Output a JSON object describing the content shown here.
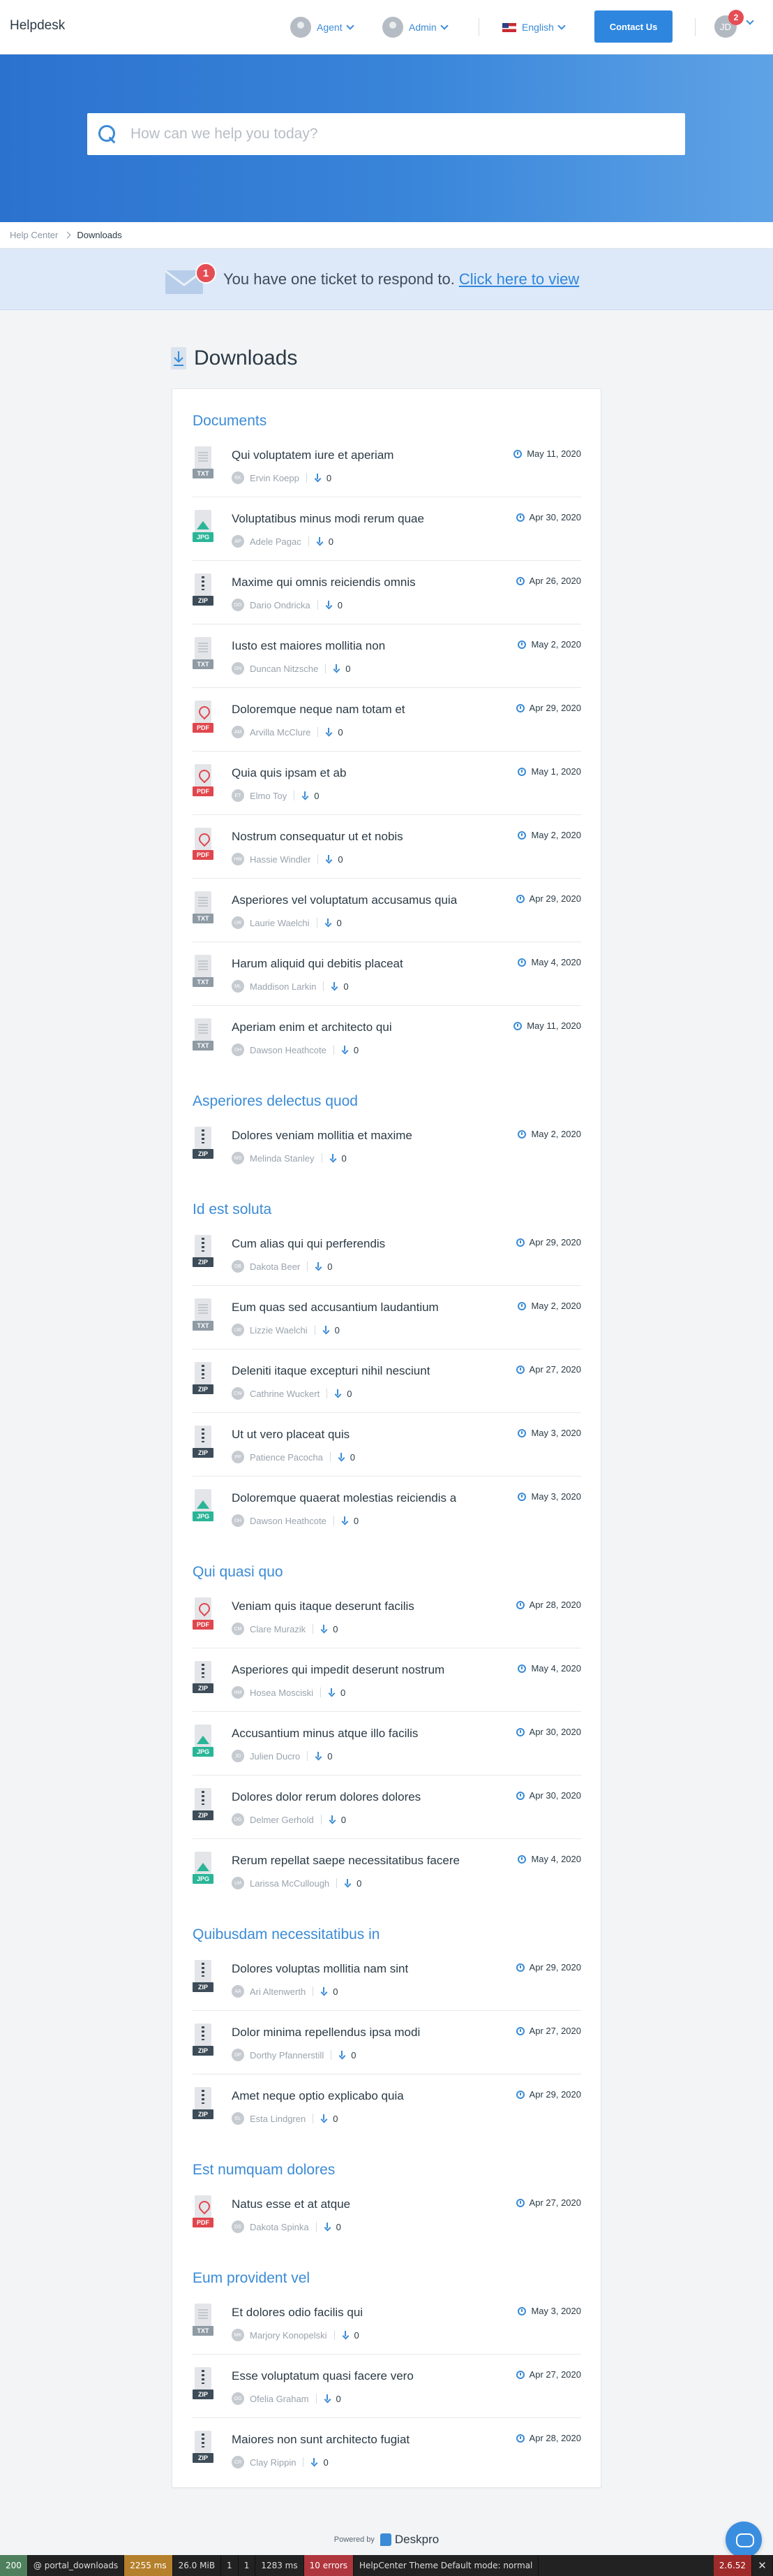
{
  "header": {
    "brand": "Helpdesk",
    "agent_label": "Agent",
    "admin_label": "Admin",
    "language_label": "English",
    "contact_label": "Contact Us",
    "user_initials": "JD",
    "user_badge": "2"
  },
  "search": {
    "placeholder": "How can we help you today?"
  },
  "breadcrumb": {
    "home": "Help Center",
    "current": "Downloads"
  },
  "ticket_notice": {
    "count": "1",
    "text": "You have one ticket to respond to.",
    "link": "Click here to view"
  },
  "page": {
    "title": "Downloads"
  },
  "sections": [
    {
      "title": "Documents",
      "items": [
        {
          "type": "TXT",
          "title": "Qui voluptatem iure et aperiam",
          "date": "May 11, 2020",
          "author": "Ervin Koepp",
          "initials": "EK",
          "count": "0"
        },
        {
          "type": "JPG",
          "title": "Voluptatibus minus modi rerum quae",
          "date": "Apr 30, 2020",
          "author": "Adele Pagac",
          "initials": "AP",
          "count": "0"
        },
        {
          "type": "ZIP",
          "title": "Maxime qui omnis reiciendis omnis",
          "date": "Apr 26, 2020",
          "author": "Dario Ondricka",
          "initials": "DO",
          "count": "0"
        },
        {
          "type": "TXT",
          "title": "Iusto est maiores mollitia non",
          "date": "May 2, 2020",
          "author": "Duncan Nitzsche",
          "initials": "DN",
          "count": "0"
        },
        {
          "type": "PDF",
          "title": "Doloremque neque nam totam et",
          "date": "Apr 29, 2020",
          "author": "Arvilla McClure",
          "initials": "AM",
          "count": "0"
        },
        {
          "type": "PDF",
          "title": "Quia quis ipsam et ab",
          "date": "May 1, 2020",
          "author": "Elmo Toy",
          "initials": "ET",
          "count": "0"
        },
        {
          "type": "PDF",
          "title": "Nostrum consequatur ut et nobis",
          "date": "May 2, 2020",
          "author": "Hassie Windler",
          "initials": "HW",
          "count": "0"
        },
        {
          "type": "TXT",
          "title": "Asperiores vel voluptatum accusamus quia",
          "date": "Apr 29, 2020",
          "author": "Laurie Waelchi",
          "initials": "LW",
          "count": "0"
        },
        {
          "type": "TXT",
          "title": "Harum aliquid qui debitis placeat",
          "date": "May 4, 2020",
          "author": "Maddison Larkin",
          "initials": "ML",
          "count": "0"
        },
        {
          "type": "TXT",
          "title": "Aperiam enim et architecto qui",
          "date": "May 11, 2020",
          "author": "Dawson Heathcote",
          "initials": "DH",
          "count": "0"
        }
      ]
    },
    {
      "title": "Asperiores delectus quod",
      "items": [
        {
          "type": "ZIP",
          "title": "Dolores veniam mollitia et maxime",
          "date": "May 2, 2020",
          "author": "Melinda Stanley",
          "initials": "MS",
          "count": "0"
        }
      ]
    },
    {
      "title": "Id est soluta",
      "items": [
        {
          "type": "ZIP",
          "title": "Cum alias qui qui perferendis",
          "date": "Apr 29, 2020",
          "author": "Dakota Beer",
          "initials": "DB",
          "count": "0"
        },
        {
          "type": "TXT",
          "title": "Eum quas sed accusantium laudantium",
          "date": "May 2, 2020",
          "author": "Lizzie Waelchi",
          "initials": "LW",
          "count": "0"
        },
        {
          "type": "ZIP",
          "title": "Deleniti itaque excepturi nihil nesciunt",
          "date": "Apr 27, 2020",
          "author": "Cathrine Wuckert",
          "initials": "CW",
          "count": "0"
        },
        {
          "type": "ZIP",
          "title": "Ut ut vero placeat quis",
          "date": "May 3, 2020",
          "author": "Patience Pacocha",
          "initials": "PP",
          "count": "0"
        },
        {
          "type": "JPG",
          "title": "Doloremque quaerat molestias reiciendis a",
          "date": "May 3, 2020",
          "author": "Dawson Heathcote",
          "initials": "DH",
          "count": "0"
        }
      ]
    },
    {
      "title": "Qui quasi quo",
      "items": [
        {
          "type": "PDF",
          "title": "Veniam quis itaque deserunt facilis",
          "date": "Apr 28, 2020",
          "author": "Clare Murazik",
          "initials": "CM",
          "count": "0"
        },
        {
          "type": "ZIP",
          "title": "Asperiores qui impedit deserunt nostrum",
          "date": "May 4, 2020",
          "author": "Hosea Mosciski",
          "initials": "HM",
          "count": "0"
        },
        {
          "type": "JPG",
          "title": "Accusantium minus atque illo facilis",
          "date": "Apr 30, 2020",
          "author": "Julien Ducro",
          "initials": "JD",
          "count": "0"
        },
        {
          "type": "ZIP",
          "title": "Dolores dolor rerum dolores dolores",
          "date": "Apr 30, 2020",
          "author": "Delmer Gerhold",
          "initials": "DG",
          "count": "0"
        },
        {
          "type": "JPG",
          "title": "Rerum repellat saepe necessitatibus facere",
          "date": "May 4, 2020",
          "author": "Larissa McCullough",
          "initials": "LM",
          "count": "0"
        }
      ]
    },
    {
      "title": "Quibusdam necessitatibus in",
      "items": [
        {
          "type": "ZIP",
          "title": "Dolores voluptas mollitia nam sint",
          "date": "Apr 29, 2020",
          "author": "Ari Altenwerth",
          "initials": "AA",
          "count": "0"
        },
        {
          "type": "ZIP",
          "title": "Dolor minima repellendus ipsa modi",
          "date": "Apr 27, 2020",
          "author": "Dorthy Pfannerstill",
          "initials": "DP",
          "count": "0"
        },
        {
          "type": "ZIP",
          "title": "Amet neque optio explicabo quia",
          "date": "Apr 29, 2020",
          "author": "Esta Lindgren",
          "initials": "EL",
          "count": "0"
        }
      ]
    },
    {
      "title": "Est numquam dolores",
      "items": [
        {
          "type": "PDF",
          "title": "Natus esse et at atque",
          "date": "Apr 27, 2020",
          "author": "Dakota Spinka",
          "initials": "DS",
          "count": "0"
        }
      ]
    },
    {
      "title": "Eum provident vel",
      "items": [
        {
          "type": "TXT",
          "title": "Et dolores odio facilis qui",
          "date": "May 3, 2020",
          "author": "Marjory Konopelski",
          "initials": "MK",
          "count": "0"
        },
        {
          "type": "ZIP",
          "title": "Esse voluptatum quasi facere vero",
          "date": "Apr 27, 2020",
          "author": "Ofelia Graham",
          "initials": "OG",
          "count": "0"
        },
        {
          "type": "ZIP",
          "title": "Maiores non sunt architecto fugiat",
          "date": "Apr 28, 2020",
          "author": "Clay Rippin",
          "initials": "CR",
          "count": "0"
        }
      ]
    }
  ],
  "footer": {
    "powered_by": "Powered by",
    "product": "Deskpro"
  },
  "debug_bar": {
    "status": "200",
    "route": "@ portal_downloads",
    "time": "2255 ms",
    "memory": "26.0 MiB",
    "c1": "1",
    "user": "1",
    "db_time": "1283 ms",
    "errors": "10 errors",
    "theme": "HelpCenter Theme Default mode: normal",
    "version": "2.6.52"
  },
  "colors": {
    "accent": "#2e86de",
    "hero_from": "#2b72cf",
    "hero_to": "#5fa3e6",
    "badge": "#e54d55"
  }
}
